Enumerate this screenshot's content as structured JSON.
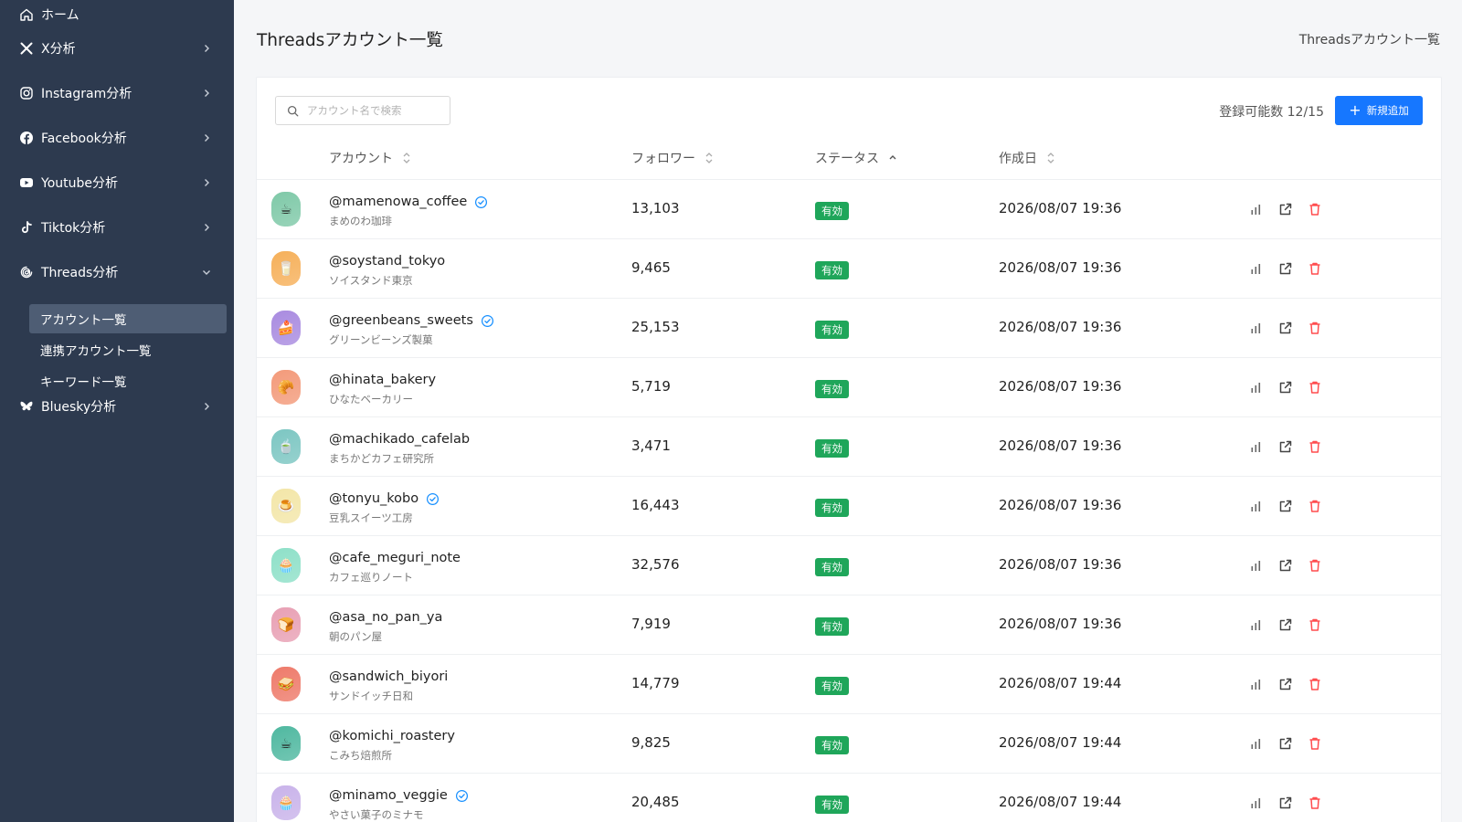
{
  "sidebar": {
    "items": [
      {
        "label": "ホーム",
        "icon": "home-icon",
        "has_chevron": false
      },
      {
        "label": "X分析",
        "icon": "x-logo-icon",
        "has_chevron": true
      },
      {
        "label": "Instagram分析",
        "icon": "instagram-icon",
        "has_chevron": true
      },
      {
        "label": "Facebook分析",
        "icon": "facebook-icon",
        "has_chevron": true
      },
      {
        "label": "Youtube分析",
        "icon": "youtube-icon",
        "has_chevron": true
      },
      {
        "label": "Tiktok分析",
        "icon": "tiktok-icon",
        "has_chevron": true
      },
      {
        "label": "Threads分析",
        "icon": "threads-icon",
        "expanded": true
      },
      {
        "label": "Bluesky分析",
        "icon": "bluesky-icon",
        "has_chevron": true
      }
    ],
    "threads_sub": [
      {
        "label": "アカウント一覧",
        "active": true
      },
      {
        "label": "連携アカウント一覧",
        "active": false
      },
      {
        "label": "キーワード一覧",
        "active": false
      }
    ]
  },
  "header": {
    "title": "Threadsアカウント一覧",
    "breadcrumb": "Threadsアカウント一覧"
  },
  "toolbar": {
    "search_placeholder": "アカウント名で検索",
    "quota": "登録可能数 12/15",
    "add_label": "新規追加"
  },
  "table": {
    "columns": [
      "アカウント",
      "フォロワー",
      "ステータス",
      "作成日"
    ],
    "rows": [
      {
        "handle": "@mamenowa_coffee",
        "name": "まめのわ珈琲",
        "verified": true,
        "followers": "13,103",
        "status": "有効",
        "created": "2026/08/07 19:36",
        "avatar_emoji": "☕",
        "avatar_color": "#7fc9a8"
      },
      {
        "handle": "@soystand_tokyo",
        "name": "ソイスタンド東京",
        "verified": false,
        "followers": "9,465",
        "status": "有効",
        "created": "2026/08/07 19:36",
        "avatar_emoji": "🥛",
        "avatar_color": "#f6b05a"
      },
      {
        "handle": "@greenbeans_sweets",
        "name": "グリーンビーンズ製菓",
        "verified": true,
        "followers": "25,153",
        "status": "有効",
        "created": "2026/08/07 19:36",
        "avatar_emoji": "🍰",
        "avatar_color": "#a98be0"
      },
      {
        "handle": "@hinata_bakery",
        "name": "ひなたベーカリー",
        "verified": false,
        "followers": "5,719",
        "status": "有効",
        "created": "2026/08/07 19:36",
        "avatar_emoji": "🥐",
        "avatar_color": "#f39a7a"
      },
      {
        "handle": "@machikado_cafelab",
        "name": "まちかどカフェ研究所",
        "verified": false,
        "followers": "3,471",
        "status": "有効",
        "created": "2026/08/07 19:36",
        "avatar_emoji": "🍵",
        "avatar_color": "#7cc6c2"
      },
      {
        "handle": "@tonyu_kobo",
        "name": "豆乳スイーツ工房",
        "verified": true,
        "followers": "16,443",
        "status": "有効",
        "created": "2026/08/07 19:36",
        "avatar_emoji": "🍮",
        "avatar_color": "#f3e6a8"
      },
      {
        "handle": "@cafe_meguri_note",
        "name": "カフェ巡りノート",
        "verified": false,
        "followers": "32,576",
        "status": "有効",
        "created": "2026/08/07 19:36",
        "avatar_emoji": "🧁",
        "avatar_color": "#8ee0c8"
      },
      {
        "handle": "@asa_no_pan_ya",
        "name": "朝のパン屋",
        "verified": false,
        "followers": "7,919",
        "status": "有効",
        "created": "2026/08/07 19:36",
        "avatar_emoji": "🍞",
        "avatar_color": "#e8a0b4"
      },
      {
        "handle": "@sandwich_biyori",
        "name": "サンドイッチ日和",
        "verified": false,
        "followers": "14,779",
        "status": "有効",
        "created": "2026/08/07 19:44",
        "avatar_emoji": "🥪",
        "avatar_color": "#ee7a6a"
      },
      {
        "handle": "@komichi_roastery",
        "name": "こみち焙煎所",
        "verified": false,
        "followers": "9,825",
        "status": "有効",
        "created": "2026/08/07 19:44",
        "avatar_emoji": "☕",
        "avatar_color": "#4fb8a0"
      },
      {
        "handle": "@minamo_veggie",
        "name": "やさい菓子のミナモ",
        "verified": true,
        "followers": "20,485",
        "status": "有効",
        "created": "2026/08/07 19:44",
        "avatar_emoji": "🧁",
        "avatar_color": "#c9b3ea"
      }
    ]
  },
  "colors": {
    "sidebar_bg": "#2d3a4f",
    "active_item": "#4e5d74",
    "primary": "#1677ff",
    "status_green": "#1fa65a",
    "delete_red": "#ff4d4f",
    "verified_blue": "#1890ff"
  }
}
